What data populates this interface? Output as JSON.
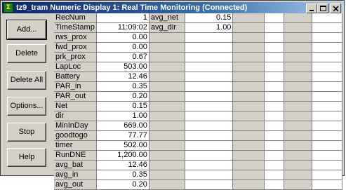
{
  "window": {
    "title": "tz9_tram Numeric Display 1: Real Time Monitoring (Connected)",
    "icon": "app-icon",
    "controls": [
      "minimize",
      "maximize",
      "close"
    ]
  },
  "buttons": {
    "add": "Add...",
    "delete": "Delete",
    "delete_all": "Delete All",
    "options": "Options...",
    "stop": "Stop",
    "help": "Help"
  },
  "col1": [
    {
      "label": "RecNum",
      "value": "1"
    },
    {
      "label": "TimeStamp",
      "value": "11:09:02"
    },
    {
      "label": "rws_prox",
      "value": "0.00"
    },
    {
      "label": "fwd_prox",
      "value": "0.00"
    },
    {
      "label": "prk_prox",
      "value": "0.67"
    },
    {
      "label": "LapLoc",
      "value": "503.00"
    },
    {
      "label": "Battery",
      "value": "12.46"
    },
    {
      "label": "PAR_in",
      "value": "0.35"
    },
    {
      "label": "PAR_out",
      "value": "0.20"
    },
    {
      "label": "Net",
      "value": "0.15"
    },
    {
      "label": "dir",
      "value": "1.00"
    },
    {
      "label": "MinInDay",
      "value": "669.00"
    },
    {
      "label": "goodtogo",
      "value": "77.77"
    },
    {
      "label": "timer",
      "value": "502.00"
    },
    {
      "label": "RunDNE",
      "value": "1,200.00"
    },
    {
      "label": "avg_bat",
      "value": "12.46"
    },
    {
      "label": "avg_in",
      "value": "0.35"
    },
    {
      "label": "avg_out",
      "value": "0.20"
    }
  ],
  "col2": [
    {
      "label": "avg_net",
      "value": "0.15"
    },
    {
      "label": "avg_dir",
      "value": "1.00"
    }
  ]
}
